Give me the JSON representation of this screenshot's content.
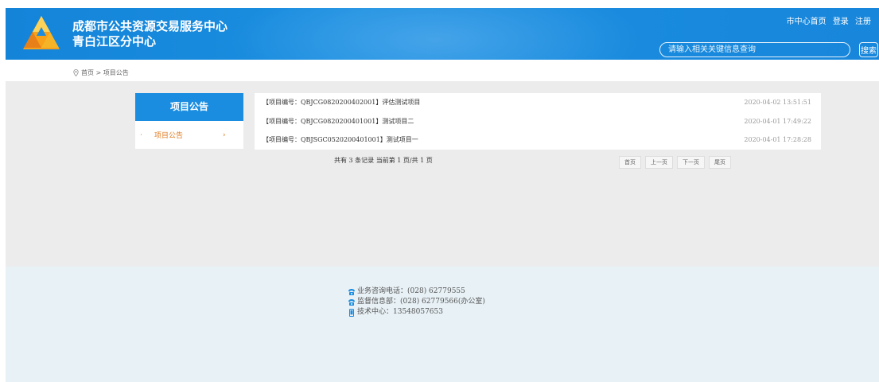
{
  "header": {
    "site_name_line1": "成都市公共资源交易服务中心",
    "site_name_line2": "青白江区分中心",
    "top_links": [
      "市中心首页",
      "登录",
      "注册"
    ],
    "search_placeholder": "请输入相关关键信息查询",
    "search_button": "搜索",
    "colors": {
      "header_bg": "#1786db",
      "accent": "#1b8de0",
      "active_item": "#e07a1f"
    }
  },
  "breadcrumb": {
    "text": "首页 > 项目公告",
    "icon": "location-pin-icon"
  },
  "sidebar": {
    "title": "项目公告",
    "items": [
      {
        "bullet": "·",
        "label": "项目公告",
        "arrow": "›"
      }
    ]
  },
  "list": {
    "rows": [
      {
        "title": "【项目编号：QBJCG0820200402001】评估测试项目",
        "date": "2020-04-02 13:51:51"
      },
      {
        "title": "【项目编号：QBJCG0820200401001】测试项目二",
        "date": "2020-04-01 17:49:22"
      },
      {
        "title": "【项目编号：QBJSGC0520200401001】测试项目一",
        "date": "2020-04-01 17:28:28"
      }
    ]
  },
  "pager": {
    "info": "共有 3 条记录 当前第 1 页/共 1 页",
    "first": "首页",
    "prev": "上一页",
    "next": "下一页",
    "last": "尾页"
  },
  "footer": {
    "phone": "业务咨询电话：(028) 62779555",
    "supervise": "监督信息部：(028) 62779566(办公室)",
    "tech": "技术中心：13548057653",
    "icons": [
      "phone-icon",
      "phone-icon",
      "mobile-icon"
    ]
  }
}
